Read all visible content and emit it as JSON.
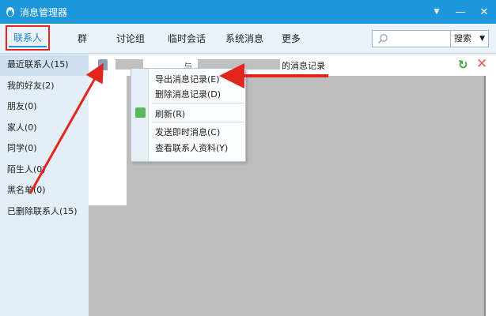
{
  "window": {
    "title": "消息管理器",
    "brand_color": "#1d96dc",
    "buttons": {
      "menu": "▼",
      "minimize": "—",
      "close": "✕"
    }
  },
  "nav": {
    "tabs": [
      {
        "label": "联系人"
      },
      {
        "label": "群"
      },
      {
        "label": "讨论组"
      },
      {
        "label": "临时会话"
      },
      {
        "label": "系统消息"
      },
      {
        "label": "更多"
      }
    ],
    "search": {
      "placeholder": "",
      "button_label": "搜索"
    }
  },
  "sidebar": {
    "items": [
      {
        "label": "最近联系人(15)"
      },
      {
        "label": "我的好友(2)"
      },
      {
        "label": "朋友(0)"
      },
      {
        "label": "家人(0)"
      },
      {
        "label": "同学(0)"
      },
      {
        "label": "陌生人(0)"
      },
      {
        "label": "黑名单(0)"
      },
      {
        "label": "已删除联系人(15)"
      }
    ]
  },
  "main": {
    "header": {
      "connector": "与",
      "suffix": "的消息记录"
    }
  },
  "context_menu": {
    "items": [
      {
        "label": "导出消息记录(E)"
      },
      {
        "label": "删除消息记录(D)"
      },
      {
        "label": "刷新(R)"
      },
      {
        "label": "发送即时消息(C)"
      },
      {
        "label": "查看联系人资料(Y)"
      }
    ]
  },
  "annotation_color": "#e3261d"
}
